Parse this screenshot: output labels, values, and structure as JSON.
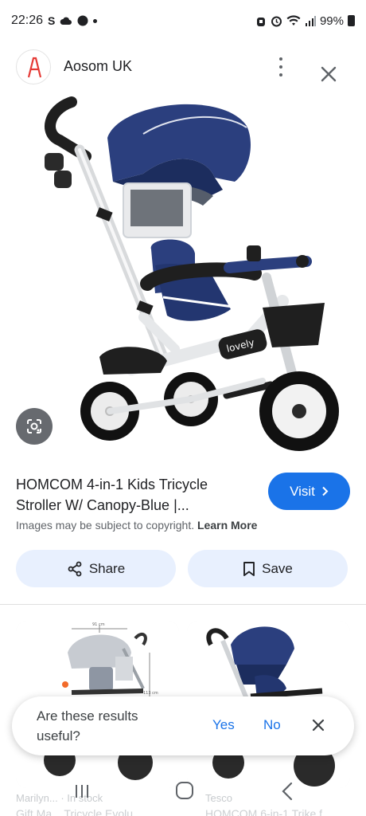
{
  "status_bar": {
    "time": "22:26",
    "left_glyph": "S",
    "battery": "99%",
    "icons": [
      "cloud-icon",
      "notification-icon",
      "alarm-icon",
      "wifi-icon",
      "signal-icon",
      "battery-icon"
    ]
  },
  "header": {
    "site_name": "Aosom UK",
    "logo_letter": "A"
  },
  "product": {
    "brand_mark": "lovely",
    "title": "HOMCOM 4-in-1 Kids Tricycle Stroller W/ Canopy-Blue |...",
    "visit_label": "Visit",
    "copyright_text": "Images may be subject to copyright.",
    "learn_more": "Learn More"
  },
  "actions": {
    "share_label": "Share",
    "save_label": "Save"
  },
  "related": [
    {
      "source": "Marilyn... · In stock",
      "title": "Gift Ma... Tricycle Evolu..."
    },
    {
      "source": "Tesco",
      "title": "HOMCOM 6-in-1 Trike f..."
    }
  ],
  "thumb_dims": {
    "width": "91 cm",
    "height": "113 cm"
  },
  "feedback": {
    "question": "Are these results useful?",
    "yes": "Yes",
    "no": "No"
  },
  "colors": {
    "accent": "#1a73e8",
    "canopy": "#2b3f7e",
    "chip_bg": "#e8f0fe"
  }
}
